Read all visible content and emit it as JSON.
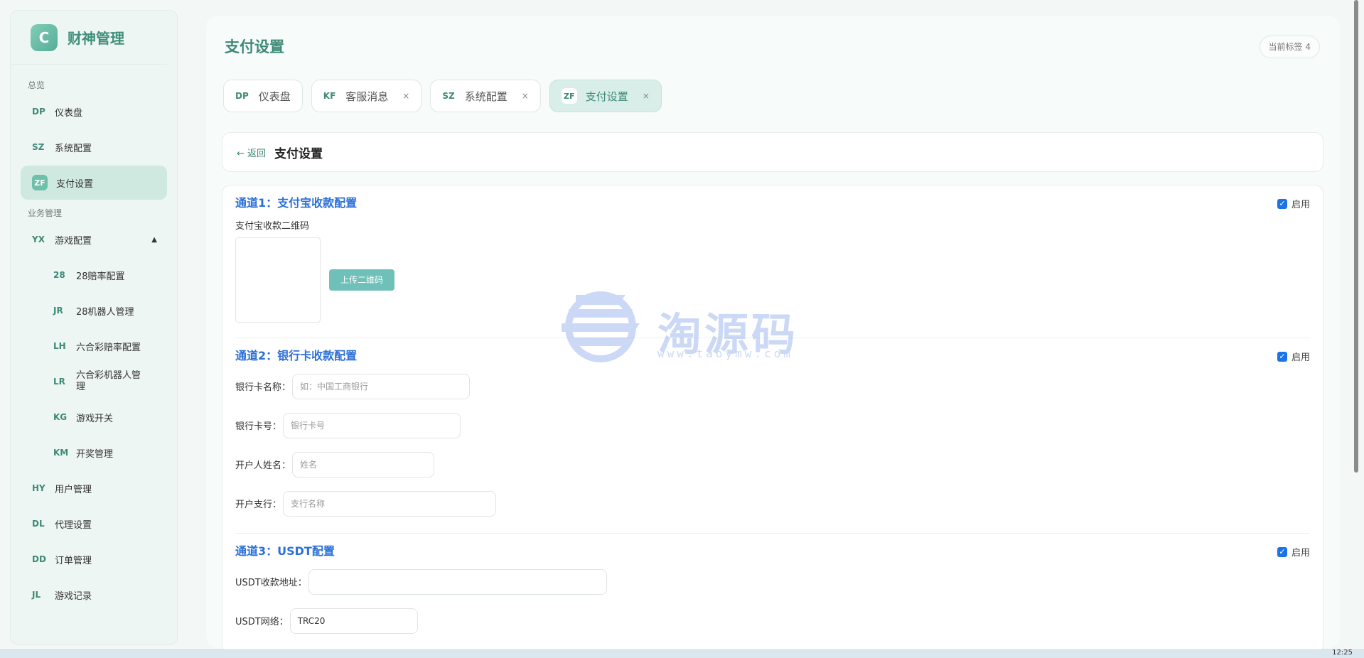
{
  "brand": {
    "logo_letter": "C",
    "name": "财神管理"
  },
  "sidebar": {
    "sections": [
      {
        "title": "总览"
      },
      {
        "title": "业务管理"
      }
    ],
    "overview_items": [
      {
        "code": "DP",
        "label": "仪表盘"
      },
      {
        "code": "SZ",
        "label": "系统配置"
      },
      {
        "code": "ZF",
        "label": "支付设置",
        "active": true
      }
    ],
    "business_items": [
      {
        "code": "YX",
        "label": "游戏配置",
        "expanded": true
      },
      {
        "code": "28",
        "label": "28赔率配置"
      },
      {
        "code": "JR",
        "label": "28机器人管理"
      },
      {
        "code": "LH",
        "label": "六合彩赔率配置"
      },
      {
        "code": "LR",
        "label": "六合彩机器人管理"
      },
      {
        "code": "KG",
        "label": "游戏开关"
      },
      {
        "code": "KM",
        "label": "开奖管理"
      },
      {
        "code": "HY",
        "label": "用户管理"
      },
      {
        "code": "DL",
        "label": "代理设置"
      },
      {
        "code": "DD",
        "label": "订单管理"
      },
      {
        "code": "JL",
        "label": "游戏记录"
      }
    ]
  },
  "header": {
    "title": "支付设置",
    "tag_count": "当前标签 4"
  },
  "tabs": [
    {
      "code": "DP",
      "label": "仪表盘"
    },
    {
      "code": "KF",
      "label": "客服消息",
      "close": "×"
    },
    {
      "code": "SZ",
      "label": "系统配置",
      "close": "×"
    },
    {
      "code": "ZF",
      "label": "支付设置",
      "close": "×",
      "active": true
    }
  ],
  "page": {
    "back": "← 返回",
    "title": "支付设置"
  },
  "channels": {
    "alipay": {
      "title": "通道1：支付宝收款配置",
      "enable_label": "启用",
      "enabled": true,
      "qr_label": "支付宝收款二维码",
      "upload_label": "上传二维码"
    },
    "bank": {
      "title": "通道2：银行卡收款配置",
      "enable_label": "启用",
      "enabled": true,
      "fields": [
        {
          "label": "银行卡名称：",
          "placeholder": "如：中国工商银行",
          "value": ""
        },
        {
          "label": "银行卡号：",
          "placeholder": "银行卡号",
          "value": ""
        },
        {
          "label": "开户人姓名：",
          "placeholder": "姓名",
          "value": ""
        },
        {
          "label": "开户支行：",
          "placeholder": "支行名称",
          "value": ""
        }
      ]
    },
    "usdt": {
      "title": "通道3：USDT配置",
      "enable_label": "启用",
      "enabled": true,
      "fields": [
        {
          "label": "USDT收款地址：",
          "placeholder": "",
          "value": ""
        },
        {
          "label": "USDT网络：",
          "placeholder": "",
          "value": "TRC20"
        }
      ]
    }
  },
  "watermark": {
    "text": "淘源码",
    "sub": "www.taoymw.com"
  },
  "taskbar": {
    "time": "12:25"
  },
  "colors": {
    "accent": "#3e8a76",
    "link": "#2b6fd8",
    "active_bg": "#cfe9e1"
  }
}
